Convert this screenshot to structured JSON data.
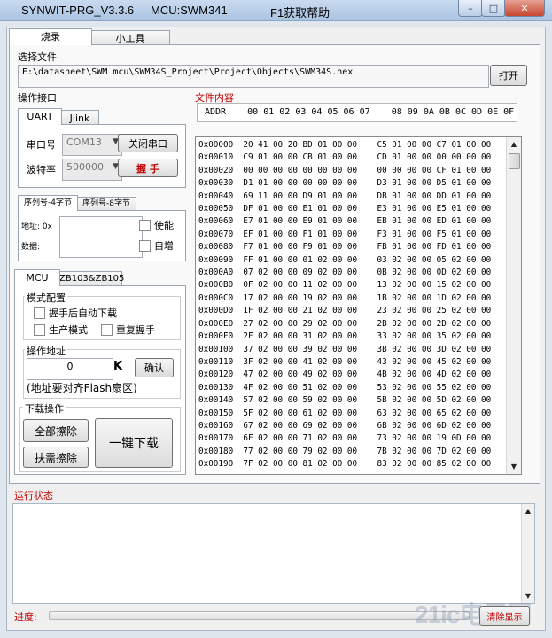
{
  "window": {
    "title": "SYNWIT-PRG_V3.3.6",
    "mcu_label": "MCU:SWM341",
    "help_label": "F1获取帮助",
    "controls": {
      "minimize": "–",
      "maximize": "□",
      "close": "✕"
    }
  },
  "main_tabs": [
    {
      "label": "烧录"
    },
    {
      "label": "小工具"
    }
  ],
  "file_select": {
    "label": "选择文件",
    "path": "E:\\datasheet\\SWM  mcu\\SWM34S_Project\\Project\\Objects\\SWM34S.hex",
    "open_button": "打开"
  },
  "port_section": {
    "label": "操作接口",
    "tabs": [
      {
        "label": "UART"
      },
      {
        "label": "Jlink"
      }
    ],
    "serial_port_label": "串口号",
    "serial_port_value": "COM13",
    "close_port_button": "关闭串口",
    "baud_label": "波特率",
    "baud_value": "500000",
    "handshake_button": "握  手"
  },
  "serial_section": {
    "tabs": [
      {
        "label": "序列号-4字节"
      },
      {
        "label": "序列号-8字节"
      }
    ],
    "address_label": "地址: 0x",
    "address_value": "",
    "enable_label": "使能",
    "value_label": "数据:",
    "value_value": "",
    "autoinc_label": "自增"
  },
  "mcu_section": {
    "tabs": [
      {
        "label": "MCU"
      },
      {
        "label": "ZB103&ZB105"
      }
    ],
    "mode_label": "模式配置",
    "auto_download_label": "握手后自动下载",
    "production_mode_label": "生产模式",
    "repeat_handshake_label": "重复握手",
    "op_addr_label": "操作地址",
    "op_addr_value": "0",
    "op_addr_unit": "K",
    "confirm_button": "确认",
    "align_note": "(地址要对齐Flash扇区)",
    "download_label": "下载操作",
    "erase_all_button": "全部擦除",
    "erase_sector_button": "扶需擦除",
    "one_click_button": "一键下载"
  },
  "file_content": {
    "label": "文件内容",
    "header": "ADDR    00 01 02 03 04 05 06 07    08 09 0A 0B 0C 0D 0E 0F",
    "rows": [
      "0x00000  20 41 00 20 BD 01 00 00    C5 01 00 00 C7 01 00 00",
      "0x00010  C9 01 00 00 CB 01 00 00    CD 01 00 00 00 00 00 00",
      "0x00020  00 00 00 00 00 00 00 00    00 00 00 00 CF 01 00 00",
      "0x00030  D1 01 00 00 00 00 00 00    D3 01 00 00 D5 01 00 00",
      "0x00040  69 11 00 00 D9 01 00 00    DB 01 00 00 DD 01 00 00",
      "0x00050  DF 01 00 00 E1 01 00 00    E3 01 00 00 E5 01 00 00",
      "0x00060  E7 01 00 00 E9 01 00 00    EB 01 00 00 ED 01 00 00",
      "0x00070  EF 01 00 00 F1 01 00 00    F3 01 00 00 F5 01 00 00",
      "0x00080  F7 01 00 00 F9 01 00 00    FB 01 00 00 FD 01 00 00",
      "0x00090  FF 01 00 00 01 02 00 00    03 02 00 00 05 02 00 00",
      "0x000A0  07 02 00 00 09 02 00 00    0B 02 00 00 0D 02 00 00",
      "0x000B0  0F 02 00 00 11 02 00 00    13 02 00 00 15 02 00 00",
      "0x000C0  17 02 00 00 19 02 00 00    1B 02 00 00 1D 02 00 00",
      "0x000D0  1F 02 00 00 21 02 00 00    23 02 00 00 25 02 00 00",
      "0x000E0  27 02 00 00 29 02 00 00    2B 02 00 00 2D 02 00 00",
      "0x000F0  2F 02 00 00 31 02 00 00    33 02 00 00 35 02 00 00",
      "0x00100  37 02 00 00 39 02 00 00    3B 02 00 00 3D 02 00 00",
      "0x00110  3F 02 00 00 41 02 00 00    43 02 00 00 45 02 00 00",
      "0x00120  47 02 00 00 49 02 00 00    4B 02 00 00 4D 02 00 00",
      "0x00130  4F 02 00 00 51 02 00 00    53 02 00 00 55 02 00 00",
      "0x00140  57 02 00 00 59 02 00 00    5B 02 00 00 5D 02 00 00",
      "0x00150  5F 02 00 00 61 02 00 00    63 02 00 00 65 02 00 00",
      "0x00160  67 02 00 00 69 02 00 00    6B 02 00 00 6D 02 00 00",
      "0x00170  6F 02 00 00 71 02 00 00    73 02 00 00 19 0D 00 00",
      "0x00180  77 02 00 00 79 02 00 00    7B 02 00 00 7D 02 00 00",
      "0x00190  7F 02 00 00 81 02 00 00    83 02 00 00 85 02 00 00"
    ]
  },
  "status": {
    "label": "运行状态",
    "progress_label": "进度:",
    "progress_value": 0,
    "clear_button": "清除显示"
  },
  "watermark": "21ic电子网",
  "colors": {
    "section_label_red": "#c00000",
    "title_bar": "#b7cde8"
  }
}
